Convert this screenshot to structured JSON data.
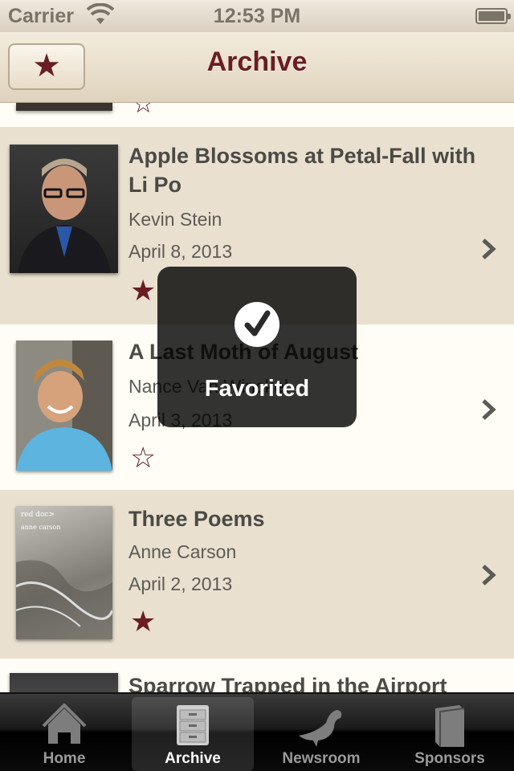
{
  "status_bar": {
    "carrier": "Carrier",
    "time": "12:53 PM"
  },
  "nav_bar": {
    "title": "Archive",
    "favorites_button": "★"
  },
  "list": {
    "items": [
      {
        "title": "Apple Blossoms at Petal-Fall with Li Po",
        "author": "Kevin Stein",
        "date": "April 8, 2013",
        "favorited": true
      },
      {
        "title": "A Last Moth of August",
        "author": "Nance Van Winckel",
        "date": "April 3, 2013",
        "favorited": false
      },
      {
        "title": "Three Poems",
        "author": "Anne Carson",
        "date": "April 2, 2013",
        "favorited": true
      },
      {
        "title": "Sparrow Trapped in the Airport",
        "author": "",
        "date": "",
        "favorited": false
      }
    ],
    "star_filled": "★",
    "star_empty": "☆",
    "book_cover_text": {
      "line1": "red doc>",
      "line2": "anne carson"
    }
  },
  "hud": {
    "label": "Favorited"
  },
  "tab_bar": {
    "tabs": [
      {
        "label": "Home",
        "icon": "house-icon",
        "active": false
      },
      {
        "label": "Archive",
        "icon": "filing-cabinet-icon",
        "active": true
      },
      {
        "label": "Newsroom",
        "icon": "bird-icon",
        "active": false
      },
      {
        "label": "Sponsors",
        "icon": "book-icon",
        "active": false
      }
    ]
  },
  "colors": {
    "accent": "#6b1d24",
    "row_tan": "#e9e0cf",
    "row_cream": "#fffdf5"
  }
}
